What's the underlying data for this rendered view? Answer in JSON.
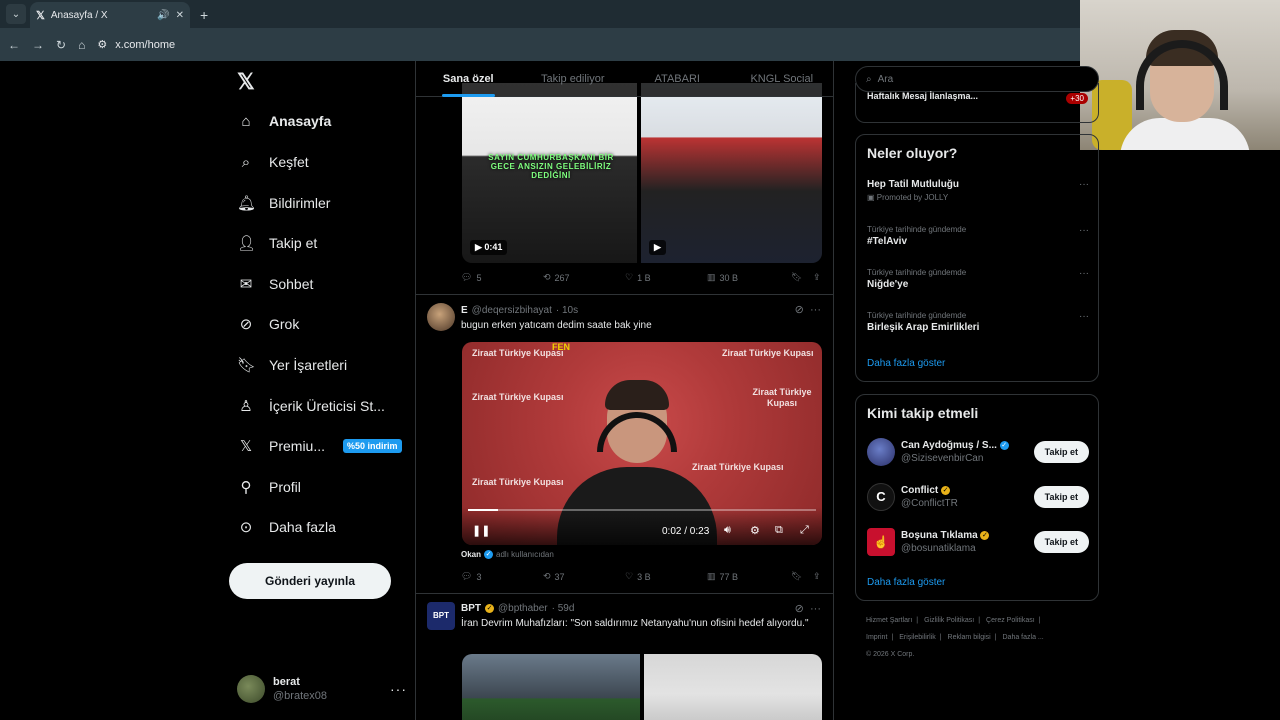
{
  "browser": {
    "tab_title": "Anasayfa / X",
    "url": "x.com/home"
  },
  "sidebar": {
    "logo": "𝕏",
    "items": [
      {
        "label": "Anasayfa",
        "icon": "home-icon"
      },
      {
        "label": "Keşfet",
        "icon": "search-icon"
      },
      {
        "label": "Bildirimler",
        "icon": "bell-icon"
      },
      {
        "label": "Takip et",
        "icon": "add-person-icon"
      },
      {
        "label": "Sohbet",
        "icon": "mail-icon"
      },
      {
        "label": "Grok",
        "icon": "grok-icon"
      },
      {
        "label": "Yer İşaretleri",
        "icon": "bookmark-icon"
      },
      {
        "label": "İçerik Üreticisi St...",
        "icon": "creator-icon"
      },
      {
        "label": "Premiu...",
        "icon": "x-icon"
      },
      {
        "label": "Profil",
        "icon": "person-icon"
      },
      {
        "label": "Daha fazla",
        "icon": "more-circle-icon"
      }
    ],
    "premium_badge": "%50 indirim",
    "post_button": "Gönderi yayınla",
    "account": {
      "name": "berat",
      "handle": "@bratex08"
    }
  },
  "feed": {
    "tabs": [
      "Sana özel",
      "Takip ediliyor",
      "ATABARI",
      "KNGL Social"
    ],
    "tweet1": {
      "overlay_text": "SAYIN CUMHURBAŞKANI BİR GECE ANSIZIN GELEBİLİRİZ DEDİĞİNİ",
      "video_time": "0:41",
      "replies": "5",
      "reposts": "267",
      "likes": "1 B",
      "views": "30 B"
    },
    "tweet2": {
      "name": "E",
      "handle": "@deqersizbihayat",
      "time": "· 10s",
      "text": "bugun erken yatıcam dedim saate bak yine",
      "video_wm": "Ziraat Türkiye Kupası",
      "video_top_tag": "FEN",
      "video_time": "0:02 / 0:23",
      "progress": 0.087,
      "attrib_name": "Okan",
      "attrib_suffix": "adlı kullanıcıdan",
      "replies": "3",
      "reposts": "37",
      "likes": "3 B",
      "views": "77 B"
    },
    "tweet3": {
      "name": "BPT",
      "handle": "@bpthaber",
      "time": "· 59d",
      "text": "İran Devrim Muhafızları: \"Son saldırımız Netanyahu'nun ofisini hedef alıyordu.\""
    }
  },
  "right": {
    "search_placeholder": "Ara",
    "top_partial": "Haftalık Mesaj İlanlaşma...",
    "top_partial_count": "+30",
    "trends_title": "Neler oluyor?",
    "trends": [
      {
        "meta": "Promoted by JOLLY",
        "title": "Hep Tatil Mutluluğu"
      },
      {
        "meta": "Türkiye tarihinde gündemde",
        "title": "#TelAviv"
      },
      {
        "meta": "Türkiye tarihinde gündemde",
        "title": "Niğde'ye"
      },
      {
        "meta": "Türkiye tarihinde gündemde",
        "title": "Birleşik Arap Emirlikleri"
      }
    ],
    "show_more": "Daha fazla göster",
    "who_title": "Kimi takip etmeli",
    "who": [
      {
        "name": "Can Aydoğmuş / S...",
        "handle": "@SizisevenbirCan",
        "verified_color": "#1d9bf0"
      },
      {
        "name": "Conflict",
        "handle": "@ConflictTR",
        "verified_color": "#e8b21a"
      },
      {
        "name": "Boşuna Tıklama",
        "handle": "@bosunatiklama",
        "verified_color": "#e8b21a"
      }
    ],
    "follow_label": "Takip et",
    "footer": [
      "Hizmet Şartları",
      "|",
      "Gizlilik Politikası",
      "|",
      "Çerez Politikası",
      "|",
      "Imprint",
      "|",
      "Erişilebilirlik",
      "|",
      "Reklam bilgisi",
      "|",
      "Daha fazla ...",
      "© 2026 X Corp."
    ]
  }
}
